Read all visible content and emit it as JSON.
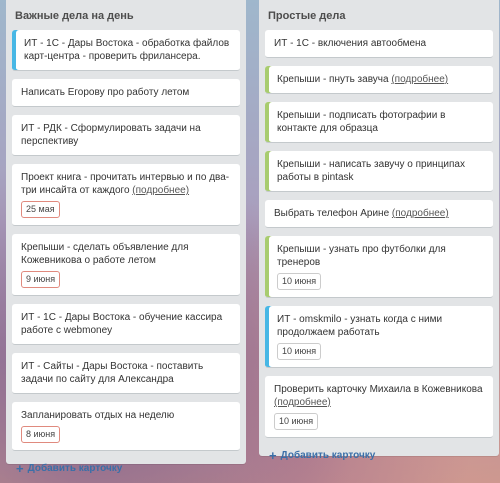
{
  "lists": [
    {
      "title": "Важные дела на день",
      "add_label": "Добавить карточку",
      "cards": [
        {
          "text": "ИТ - 1С - Дары Востока - обработка файлов карт-центра - проверить фрилансера.",
          "bar": "blue"
        },
        {
          "text": "Написать Егорову про работу летом"
        },
        {
          "text": "ИТ - РДК - Сформулировать задачи на перспективу"
        },
        {
          "text": "Проект книга - прочитать интервью и по два-три инсайта от каждого ",
          "more": "(подробнее)",
          "due": "25 мая"
        },
        {
          "text": "Крепыши - сделать объявление для Кожевникова о работе летом",
          "due": "9 июня"
        },
        {
          "text": "ИТ - 1С - Дары Востока - обучение кассира работе с webmoney"
        },
        {
          "text": "ИТ - Сайты - Дары Востока - поставить задачи по сайту для Александра"
        },
        {
          "text": "Запланировать отдых на неделю",
          "due": "8 июня"
        }
      ]
    },
    {
      "title": "Простые дела",
      "add_label": "Добавить карточку",
      "cards": [
        {
          "text": "ИТ - 1С - включения автообмена"
        },
        {
          "text": "Крепыши - пнуть завуча ",
          "more": "(подробнее)",
          "bar": "green"
        },
        {
          "text": "Крепыши - подписать фотографии в контакте для образца",
          "bar": "green"
        },
        {
          "text": "Крепыши - написать завучу о принципах работы в pintask",
          "bar": "green"
        },
        {
          "text": "Выбрать телефон Арине ",
          "more": "(подробнее)"
        },
        {
          "text": "Крепыши - узнать про футболки для тренеров",
          "bar": "green",
          "due": "10 июня"
        },
        {
          "text": "ИТ - omskmilo - узнать когда с ними продолжаем работать",
          "bar": "blue",
          "due": "10 июня"
        },
        {
          "text": "Проверить карточку Михаила в Кожевникова ",
          "more": "(подробнее)",
          "due": "10 июня"
        }
      ]
    }
  ]
}
